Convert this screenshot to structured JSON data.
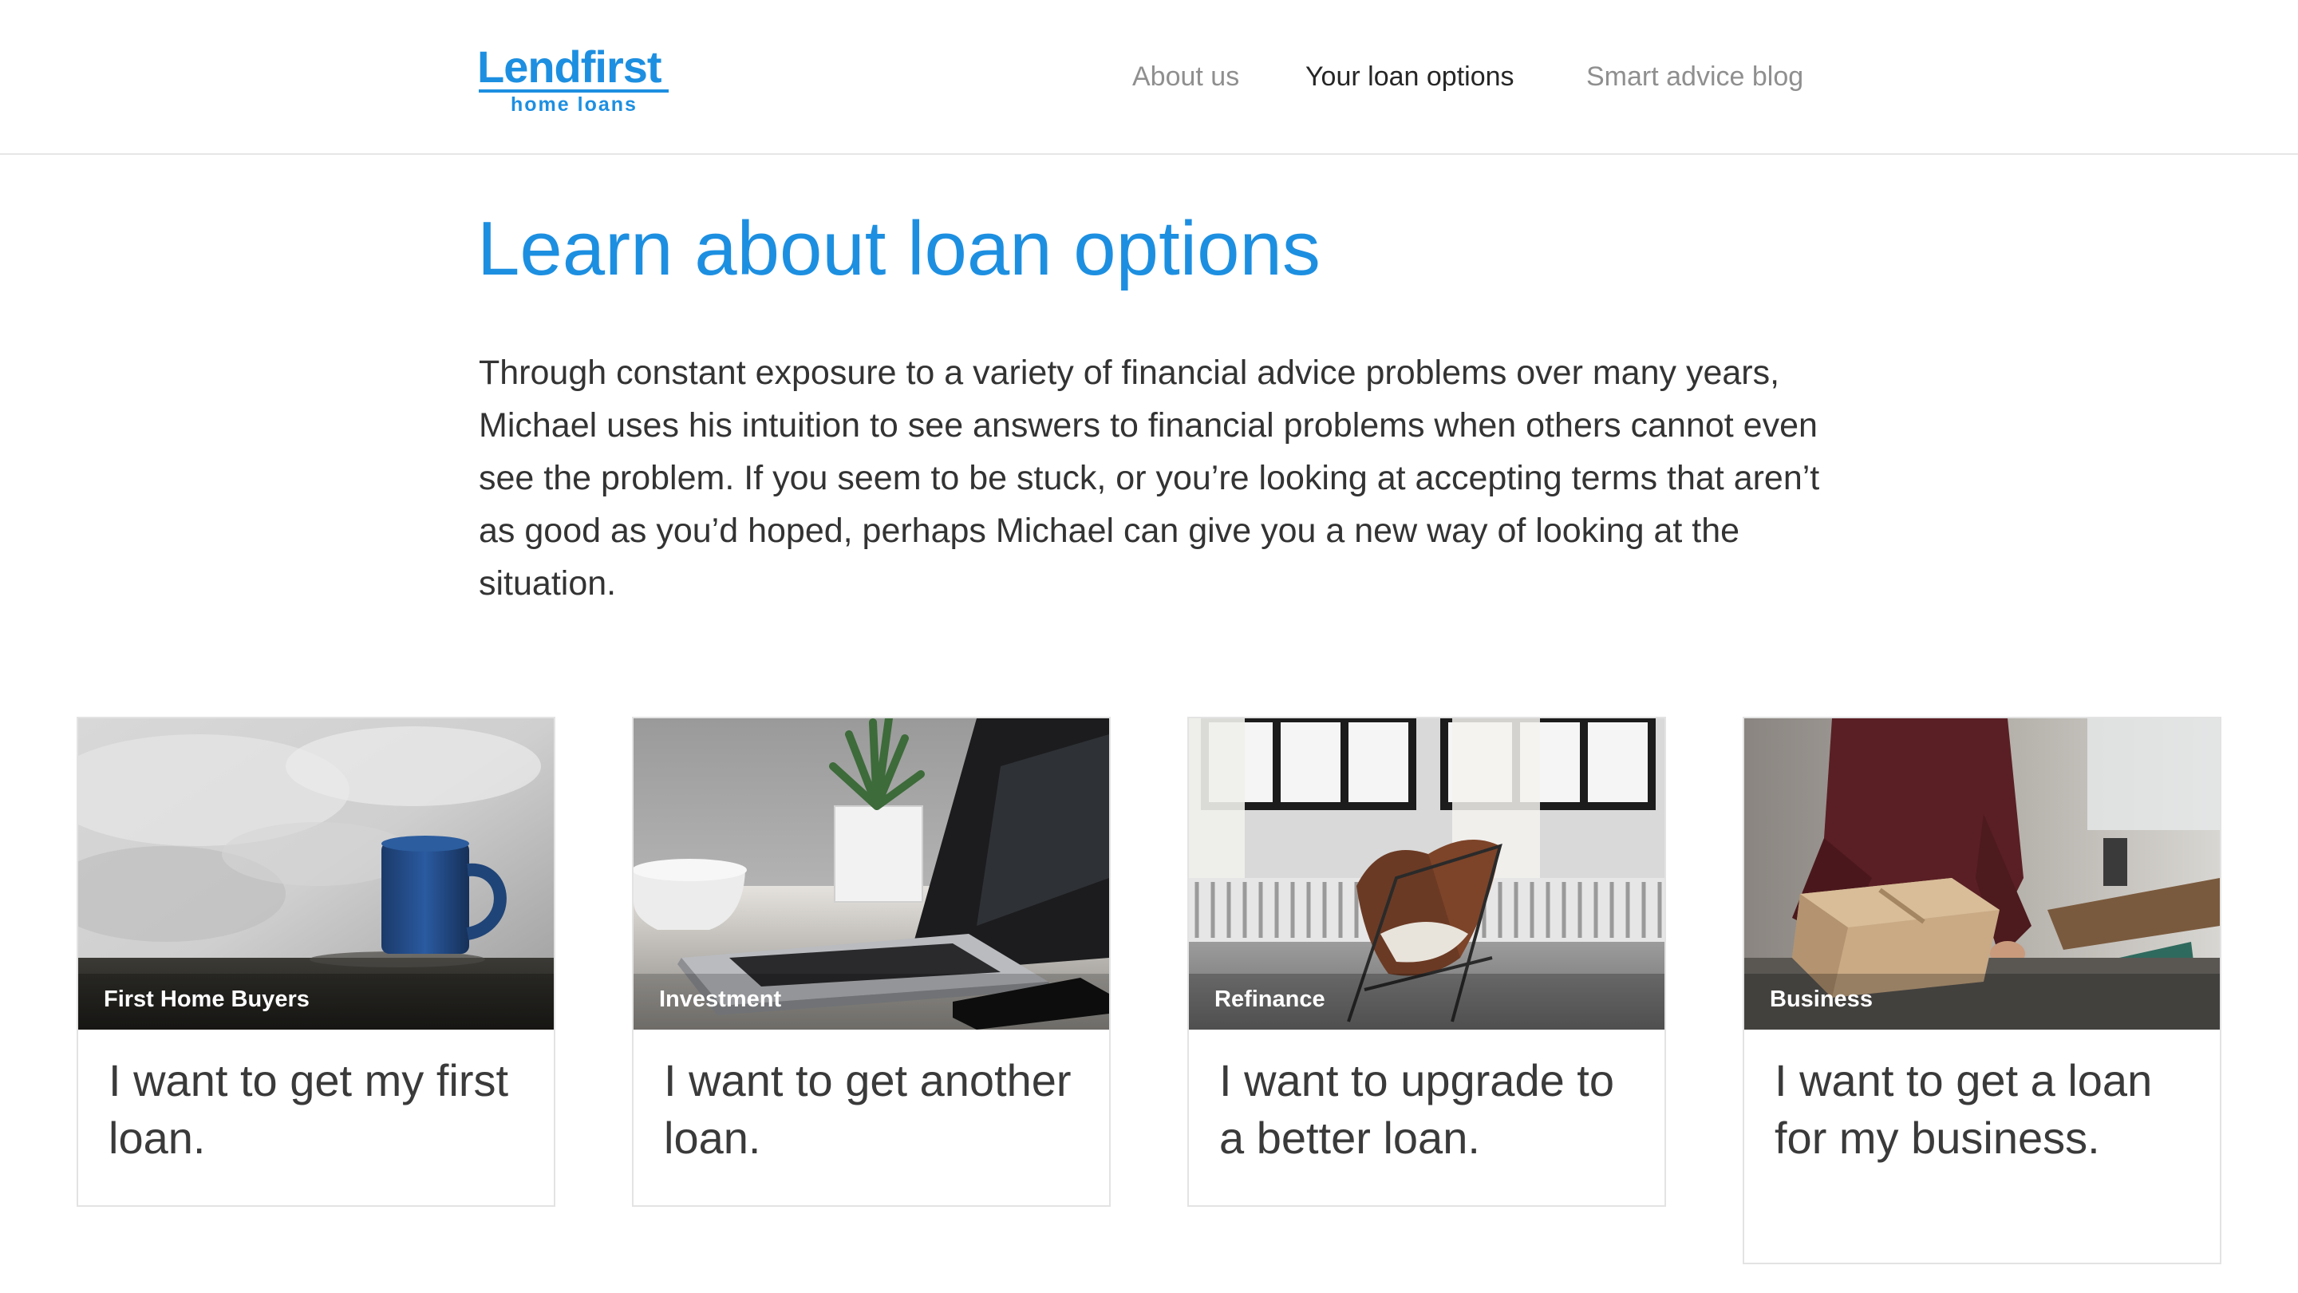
{
  "brand": {
    "name": "Lendfirst",
    "tagline": "home loans",
    "color": "#1d8fe1"
  },
  "nav": {
    "items": [
      {
        "label": "About us",
        "active": false
      },
      {
        "label": "Your loan options",
        "active": true
      },
      {
        "label": "Smart advice blog",
        "active": false
      }
    ]
  },
  "main": {
    "title": "Learn about loan options",
    "intro": "Through constant exposure to a variety of financial advice problems over many years, Michael uses his intuition to see answers to financial problems when others cannot even see the problem. If you seem to be stuck, or you’re looking at accepting terms that aren’t as good as you’d hoped, perhaps Michael can give you a new way of looking at the situation."
  },
  "cards": [
    {
      "tag": "First Home Buyers",
      "text": "I want to get my first loan.",
      "image": "coffee-mug-on-bedside-photo"
    },
    {
      "tag": "Investment",
      "text": "I want to get another loan.",
      "image": "laptop-on-desk-photo"
    },
    {
      "tag": "Refinance",
      "text": "I want to upgrade to a better loan.",
      "image": "butterfly-chair-by-window-photo"
    },
    {
      "tag": "Business",
      "text": "I want to get a loan for my business.",
      "image": "person-packing-box-photo"
    }
  ]
}
